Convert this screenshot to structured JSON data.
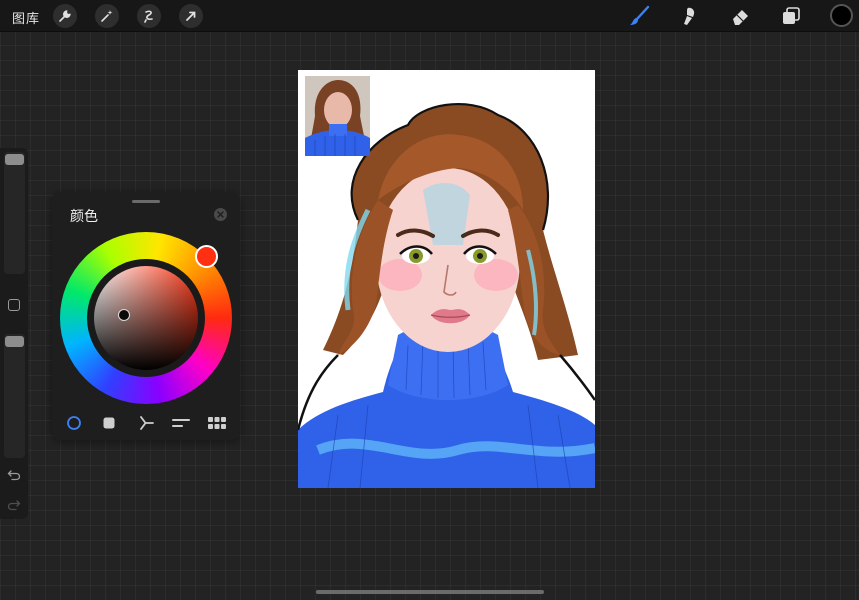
{
  "topbar": {
    "gallery_label": "图库",
    "left_tools": [
      "wrench-icon",
      "magic-wand-icon",
      "selection-icon",
      "transform-arrow-icon"
    ],
    "right_tools": [
      "brush-icon",
      "smudge-icon",
      "eraser-icon",
      "layers-icon"
    ],
    "active_tool": "brush-icon",
    "current_color": "#000000",
    "accent_color": "#3b82f6"
  },
  "color_panel": {
    "title": "颜色",
    "selected_hue": "#ff2f12",
    "modes": [
      "disc-mode-icon",
      "classic-mode-icon",
      "harmony-mode-icon",
      "value-mode-icon",
      "palettes-mode-icon"
    ],
    "active_mode": "disc-mode-icon"
  },
  "sidebar": {
    "controls": [
      "brush-size-slider",
      "modify-button",
      "opacity-slider",
      "undo-icon",
      "redo-icon"
    ]
  }
}
